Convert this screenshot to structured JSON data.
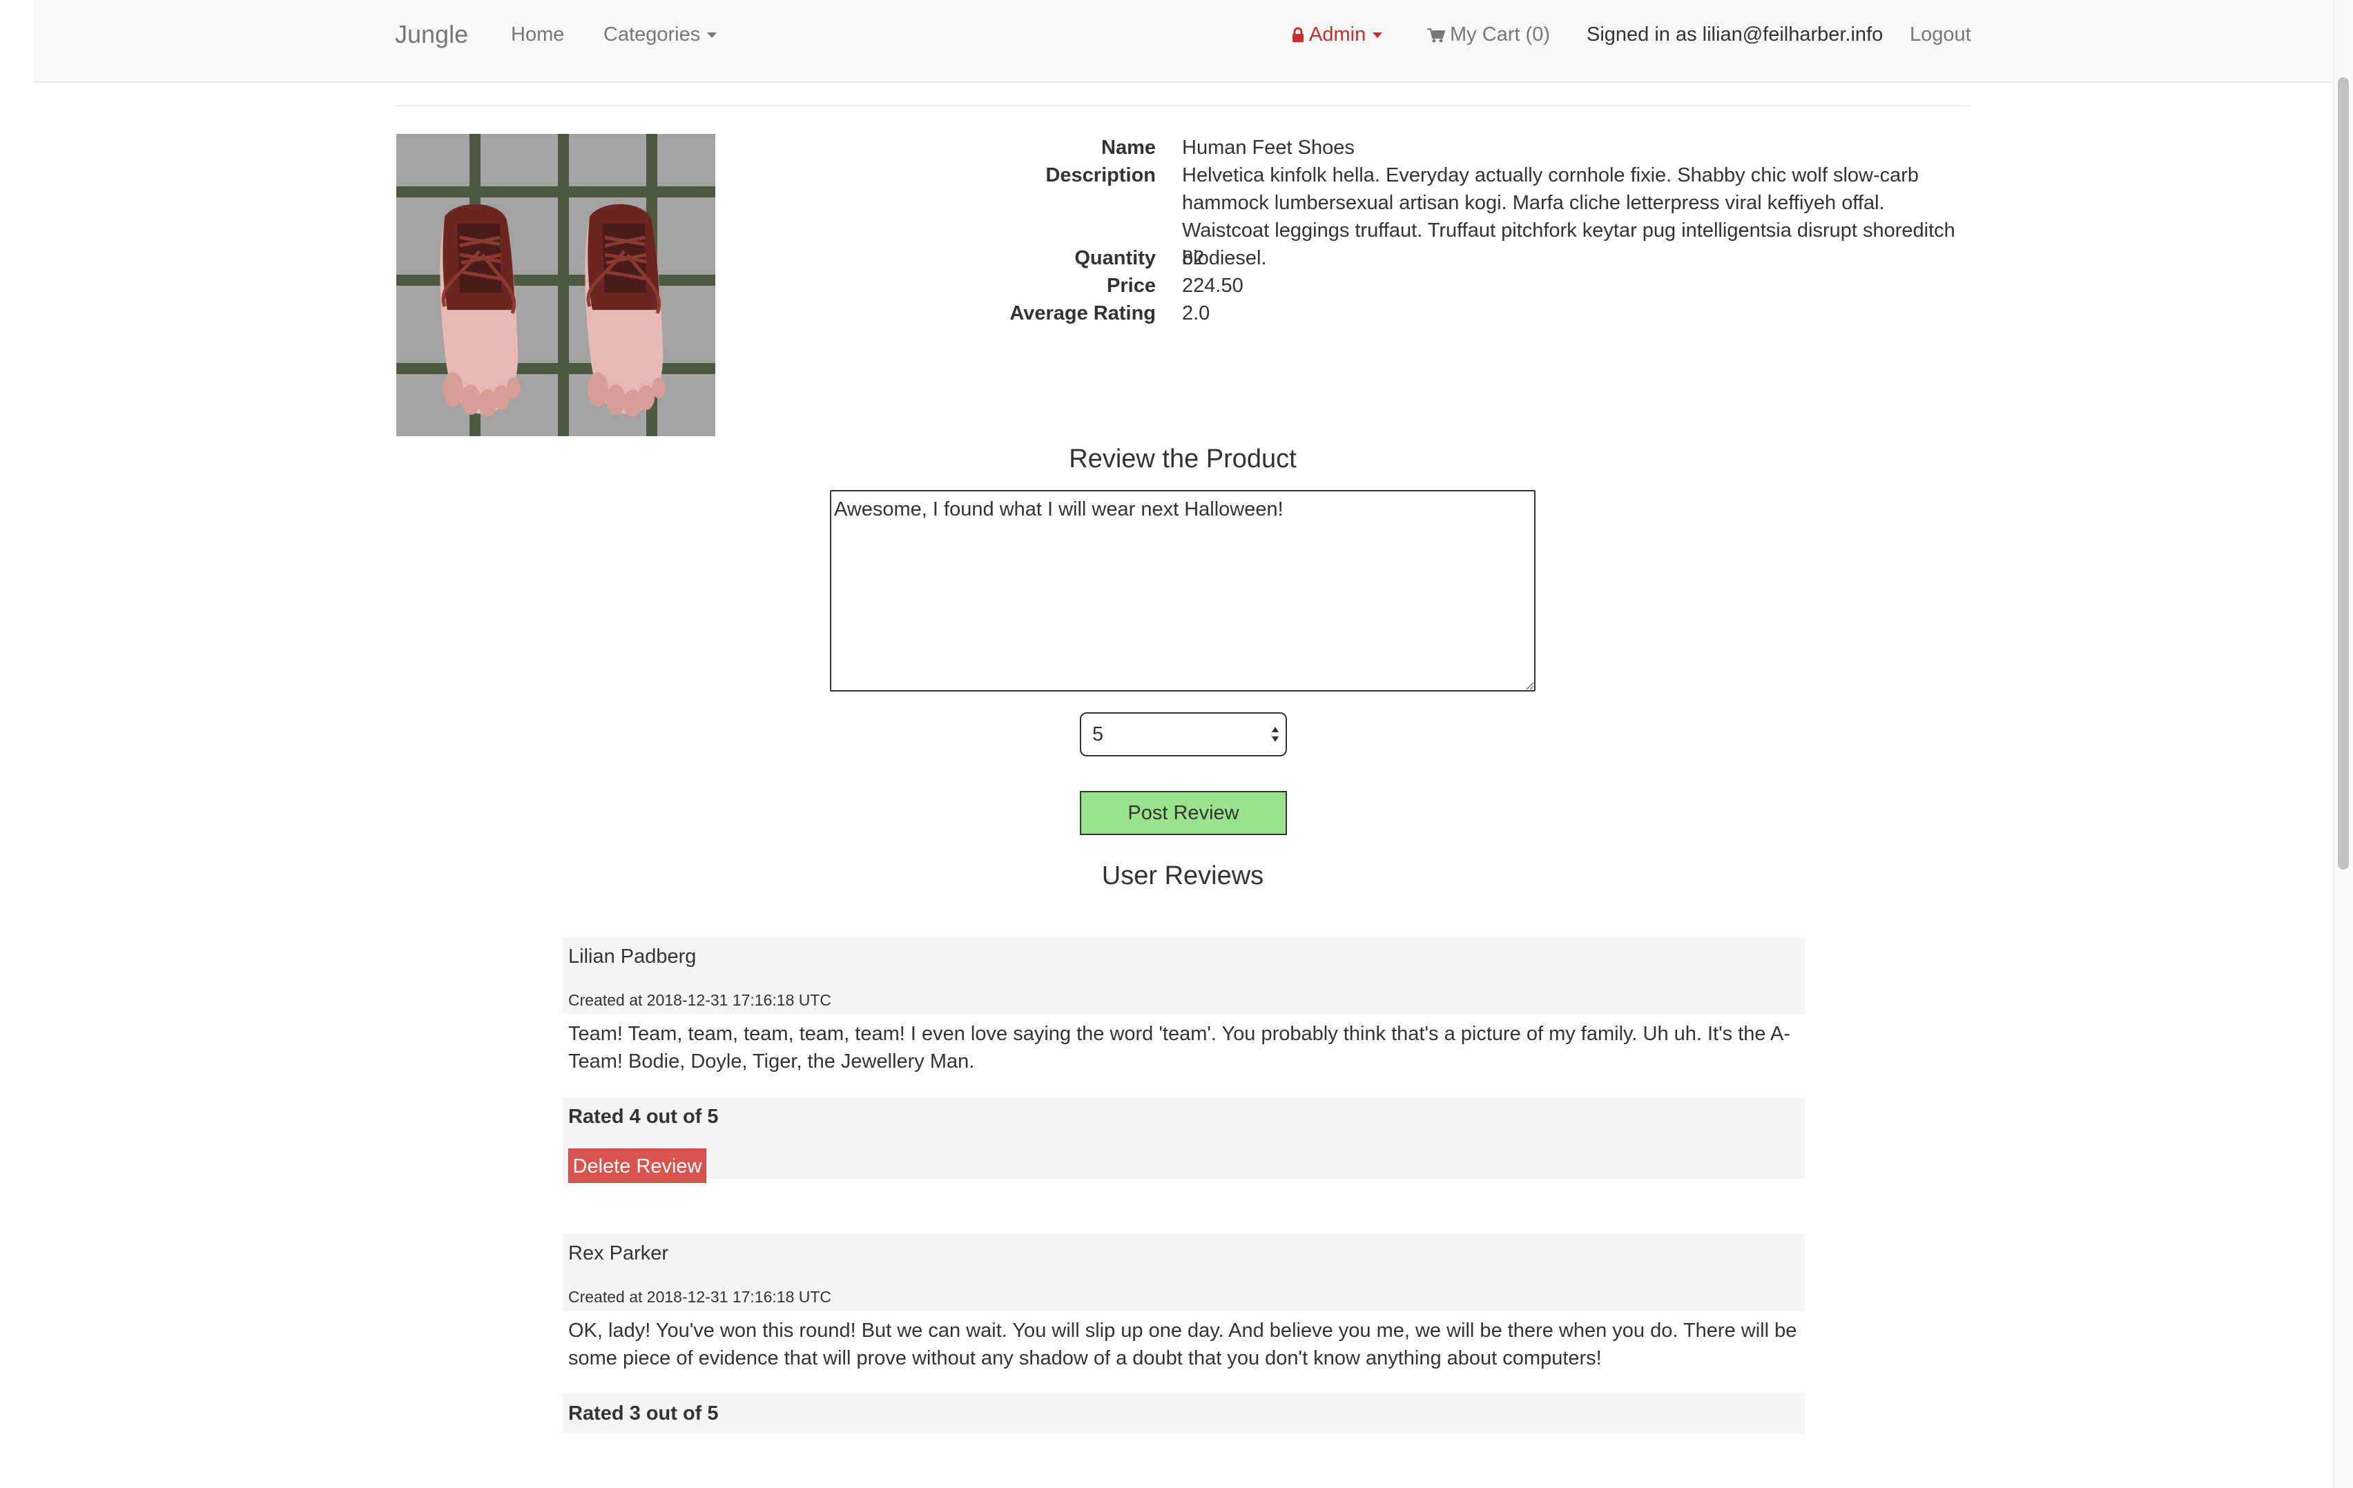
{
  "navbar": {
    "brand": "Jungle",
    "home": "Home",
    "categories": "Categories",
    "admin": "Admin",
    "cart": "My Cart (0)",
    "signed_in": "Signed in as lilian@feilharber.info",
    "logout": "Logout"
  },
  "product": {
    "image_alt": "Human Feet Shoes",
    "fields": {
      "name_label": "Name",
      "name": "Human Feet Shoes",
      "description_label": "Description",
      "description": "Helvetica kinfolk hella. Everyday actually cornhole fixie. Shabby chic wolf slow-carb hammock lumbersexual artisan kogi. Marfa cliche letterpress viral keffiyeh offal. Waistcoat leggings truffaut. Truffaut pitchfork keytar pug intelligentsia disrupt shoreditch biodiesel.",
      "quantity_label": "Quantity",
      "quantity": "82",
      "price_label": "Price",
      "price": "224.50",
      "rating_label": "Average Rating",
      "rating": "2.0"
    }
  },
  "review_form": {
    "title": "Review the Product",
    "text_value": "Awesome, I found what I will wear next Halloween!",
    "rating_value": "5",
    "submit_label": "Post Review"
  },
  "reviews": {
    "title": "User Reviews",
    "items": [
      {
        "author": "Lilian Padberg",
        "created": "Created at 2018-12-31 17:16:18 UTC",
        "body": "Team! Team, team, team, team, team! I even love saying the word 'team'. You probably think that's a picture of my family. Uh uh. It's the A-Team! Bodie, Doyle, Tiger, the Jewellery Man.",
        "rating": "Rated 4 out of 5",
        "delete_label": "Delete Review"
      },
      {
        "author": "Rex Parker",
        "created": "Created at 2018-12-31 17:16:18 UTC",
        "body": "OK, lady! You've won this round! But we can wait. You will slip up one day. And believe you me, we will be there when you do. There will be some piece of evidence that will prove without any shadow of a doubt that you don't know anything about computers!",
        "rating": "Rated 3 out of 5"
      }
    ]
  },
  "icons": {
    "lock": "lock-icon",
    "cart": "cart-icon",
    "caret": "caret-down-icon"
  },
  "colors": {
    "navbar_bg": "#f8f8f8",
    "admin_red": "#c9302c",
    "post_green": "#9be38b",
    "delete_red": "#d9534f",
    "review_bg": "#f5f5f5"
  }
}
